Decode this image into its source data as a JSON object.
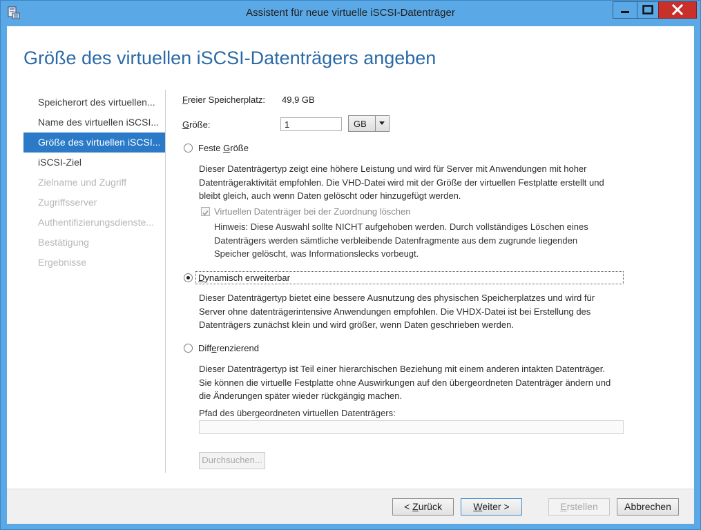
{
  "window": {
    "title": "Assistent für neue virtuelle iSCSI-Datenträger"
  },
  "page": {
    "heading": "Größe des virtuellen iSCSI-Datenträgers angeben"
  },
  "nav": {
    "items": [
      {
        "label": "Speicherort des virtuellen...",
        "state": "normal"
      },
      {
        "label": "Name des virtuellen iSCSI...",
        "state": "normal"
      },
      {
        "label": "Größe des virtuellen iSCSI...",
        "state": "selected"
      },
      {
        "label": "iSCSI-Ziel",
        "state": "normal"
      },
      {
        "label": "Zielname und Zugriff",
        "state": "disabled"
      },
      {
        "label": "Zugriffsserver",
        "state": "disabled"
      },
      {
        "label": "Authentifizierungsdienste...",
        "state": "disabled"
      },
      {
        "label": "Bestätigung",
        "state": "disabled"
      },
      {
        "label": "Ergebnisse",
        "state": "disabled"
      }
    ]
  },
  "free_space": {
    "label_pre": "",
    "label_u": "F",
    "label_post": "reier Speicherplatz:",
    "value": "49,9 GB"
  },
  "size": {
    "label_pre": "",
    "label_u": "G",
    "label_post": "röße:",
    "value": "1",
    "unit": "GB"
  },
  "fixed": {
    "label_pre": "Feste ",
    "label_u": "G",
    "label_post": "röße",
    "checked": false,
    "desc": "Dieser Datenträgertyp zeigt eine höhere Leistung und wird für Server mit Anwendungen mit hoher Datenträgeraktivität empfohlen. Die VHD-Datei wird mit der Größe der virtuellen Festplatte erstellt und bleibt gleich, auch wenn Daten gelöscht oder hinzugefügt werden.",
    "checkbox_label": "Virtuellen Datenträger bei der Zuordnung löschen",
    "checkbox_checked": true,
    "hint": "Hinweis: Diese Auswahl sollte NICHT aufgehoben werden. Durch vollständiges Löschen eines Datenträgers werden sämtliche verbleibende Datenfragmente aus dem zugrunde liegenden Speicher gelöscht, was Informationslecks vorbeugt."
  },
  "dynamic": {
    "label_pre": "",
    "label_u": "D",
    "label_post": "ynamisch erweiterbar",
    "checked": true,
    "desc": "Dieser Datenträgertyp bietet eine bessere Ausnutzung des physischen Speicherplatzes und wird für Server ohne datenträgerintensive Anwendungen empfohlen. Die VHDX-Datei ist bei Erstellung des Datenträgers zunächst klein und wird größer, wenn Daten geschrieben werden."
  },
  "differencing": {
    "label_pre": "Diff",
    "label_u": "e",
    "label_post": "renzierend",
    "checked": false,
    "desc": "Dieser Datenträgertyp ist Teil einer hierarchischen Beziehung mit einem anderen intakten Datenträger. Sie können die virtuelle Festplatte ohne Auswirkungen auf den übergeordneten Datenträger ändern und die Änderungen später wieder rückgängig machen.",
    "parent_label": "Pfad des übergeordneten virtuellen Datenträgers:",
    "parent_value": "",
    "browse_label": "Durchsuchen..."
  },
  "footer": {
    "back_pre": "< ",
    "back_u": "Z",
    "back_post": "urück",
    "next_pre": "",
    "next_u": "W",
    "next_post": "eiter >",
    "create_pre": "",
    "create_u": "E",
    "create_post": "rstellen",
    "cancel_label": "Abbrechen"
  }
}
